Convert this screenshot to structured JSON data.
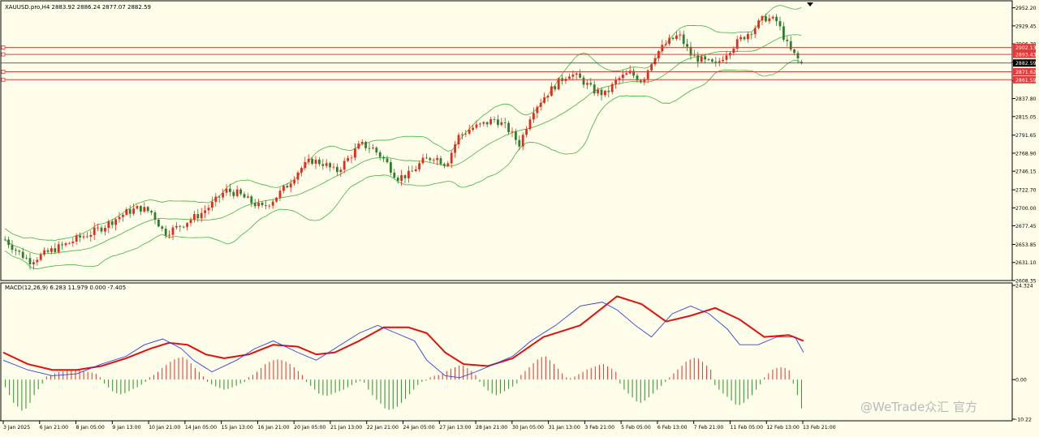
{
  "main_header": "XAUUSD.pro,H4  2883.92 2886.24 2877.07 2882.59",
  "macd_header": "MACD(12,26,9) 6.283 11.979 0.000 -7.405",
  "watermark": "@WeTrade众汇 官方",
  "colors": {
    "background": "#fffeea",
    "bull": "#e8291c",
    "bear": "#2f7d2f",
    "bollinger": "#3cb43c",
    "hline": "#e53a3a",
    "price_line": "#333333",
    "macd": "#2f3fe0",
    "signal": "#e01010",
    "hist_pos": "#e8403a",
    "hist_neg": "#3a9a3a"
  },
  "chart_data": [
    {
      "type": "candlestick",
      "symbol": "XAUUSD.pro",
      "timeframe": "H4",
      "last_ohlc": {
        "open": 2883.92,
        "high": 2886.24,
        "low": 2877.07,
        "close": 2882.59
      },
      "ylim": [
        2608.35,
        2960.0
      ],
      "y_ticks": [
        "2952.20",
        "2929.45",
        "2906.70",
        "2883.95",
        "2860.30",
        "2837.80",
        "2815.05",
        "2791.65",
        "2768.90",
        "2746.15",
        "2722.70",
        "2700.00",
        "2677.45",
        "2653.85",
        "2631.10",
        "2608.35"
      ],
      "x_labels": [
        "3 Jan 2025",
        "6 Jan 21:00",
        "8 Jan 05:00",
        "9 Jan 13:00",
        "10 Jan 21:00",
        "14 Jan 05:00",
        "15 Jan 13:00",
        "16 Jan 21:00",
        "20 Jan 05:00",
        "21 Jan 13:00",
        "22 Jan 21:00",
        "24 Jan 05:00",
        "27 Jan 13:00",
        "28 Jan 21:00",
        "30 Jan 05:00",
        "31 Jan 13:00",
        "3 Feb 21:00",
        "5 Feb 05:00",
        "6 Feb 13:00",
        "7 Feb 21:00",
        "11 Feb 05:00",
        "12 Feb 13:00",
        "13 Feb 21:00"
      ],
      "horizontal_lines": [
        {
          "label": "2902.13",
          "value": 2902.13
        },
        {
          "label": "2893.43",
          "value": 2893.43
        },
        {
          "label": "2871.62",
          "value": 2871.62
        },
        {
          "label": "2861.59",
          "value": 2861.59
        }
      ],
      "current_price": {
        "label": "2882.59",
        "value": 2882.59
      },
      "close_path": [
        [
          0,
          2660
        ],
        [
          8,
          2645
        ],
        [
          16,
          2633
        ],
        [
          24,
          2640
        ],
        [
          32,
          2648
        ],
        [
          40,
          2654
        ],
        [
          48,
          2662
        ],
        [
          56,
          2668
        ],
        [
          64,
          2676
        ],
        [
          72,
          2686
        ],
        [
          80,
          2695
        ],
        [
          88,
          2700
        ],
        [
          96,
          2694
        ],
        [
          104,
          2668
        ],
        [
          112,
          2675
        ],
        [
          120,
          2684
        ],
        [
          128,
          2693
        ],
        [
          136,
          2706
        ],
        [
          144,
          2722
        ],
        [
          152,
          2718
        ],
        [
          160,
          2708
        ],
        [
          168,
          2700
        ],
        [
          176,
          2712
        ],
        [
          184,
          2728
        ],
        [
          192,
          2748
        ],
        [
          200,
          2760
        ],
        [
          208,
          2756
        ],
        [
          216,
          2745
        ],
        [
          224,
          2762
        ],
        [
          232,
          2780
        ],
        [
          240,
          2775
        ],
        [
          248,
          2760
        ],
        [
          256,
          2738
        ],
        [
          264,
          2742
        ],
        [
          272,
          2758
        ],
        [
          280,
          2765
        ],
        [
          288,
          2755
        ],
        [
          296,
          2790
        ],
        [
          304,
          2800
        ],
        [
          312,
          2805
        ],
        [
          320,
          2812
        ],
        [
          328,
          2800
        ],
        [
          336,
          2780
        ],
        [
          344,
          2822
        ],
        [
          352,
          2840
        ],
        [
          360,
          2856
        ],
        [
          368,
          2870
        ],
        [
          376,
          2862
        ],
        [
          384,
          2848
        ],
        [
          392,
          2843
        ],
        [
          400,
          2862
        ],
        [
          408,
          2870
        ],
        [
          416,
          2860
        ],
        [
          424,
          2892
        ],
        [
          432,
          2908
        ],
        [
          440,
          2918
        ],
        [
          448,
          2892
        ],
        [
          456,
          2885
        ],
        [
          464,
          2880
        ],
        [
          472,
          2898
        ],
        [
          480,
          2912
        ],
        [
          488,
          2925
        ],
        [
          496,
          2940
        ],
        [
          504,
          2935
        ],
        [
          512,
          2900
        ],
        [
          520,
          2882.59
        ]
      ],
      "close_path_note_x": "bar index 0–520"
    },
    {
      "type": "line",
      "indicator": "MACD",
      "params": [
        12,
        26,
        9
      ],
      "values_shown": {
        "macd": 6.283,
        "signal": 11.979,
        "hist_zero": 0.0,
        "hist": -7.405
      },
      "ylim": [
        -10.22,
        24.324
      ],
      "y_ticks": [
        "24.324",
        "0.00",
        "-10.22"
      ],
      "macd_path": [
        [
          0,
          5
        ],
        [
          20,
          2.5
        ],
        [
          40,
          1
        ],
        [
          60,
          1.5
        ],
        [
          80,
          4
        ],
        [
          100,
          6
        ],
        [
          115,
          9
        ],
        [
          130,
          10.5
        ],
        [
          145,
          8
        ],
        [
          155,
          5
        ],
        [
          170,
          2
        ],
        [
          190,
          5
        ],
        [
          205,
          8
        ],
        [
          220,
          10
        ],
        [
          240,
          7
        ],
        [
          255,
          5
        ],
        [
          270,
          8
        ],
        [
          290,
          12
        ],
        [
          305,
          14
        ],
        [
          320,
          12
        ],
        [
          335,
          10
        ],
        [
          345,
          5
        ],
        [
          360,
          1
        ],
        [
          372,
          0.5
        ],
        [
          385,
          2
        ],
        [
          400,
          4
        ],
        [
          415,
          6
        ],
        [
          430,
          10
        ],
        [
          450,
          14
        ],
        [
          470,
          19
        ],
        [
          488,
          20
        ],
        [
          500,
          18
        ],
        [
          515,
          14
        ],
        [
          528,
          11
        ],
        [
          545,
          17
        ],
        [
          560,
          19
        ],
        [
          575,
          17
        ],
        [
          590,
          13
        ],
        [
          600,
          9
        ],
        [
          615,
          9
        ],
        [
          630,
          11
        ],
        [
          645,
          11
        ],
        [
          652,
          7
        ]
      ],
      "signal_path": [
        [
          0,
          7
        ],
        [
          20,
          4
        ],
        [
          40,
          2.5
        ],
        [
          60,
          2.5
        ],
        [
          80,
          3.5
        ],
        [
          100,
          5.5
        ],
        [
          120,
          8
        ],
        [
          135,
          9.5
        ],
        [
          150,
          9
        ],
        [
          165,
          6.5
        ],
        [
          180,
          5.5
        ],
        [
          200,
          6.5
        ],
        [
          220,
          9
        ],
        [
          240,
          8.5
        ],
        [
          255,
          6.5
        ],
        [
          270,
          7
        ],
        [
          290,
          10
        ],
        [
          310,
          13.5
        ],
        [
          330,
          13.5
        ],
        [
          345,
          12
        ],
        [
          360,
          7
        ],
        [
          375,
          4
        ],
        [
          395,
          3.5
        ],
        [
          415,
          5.5
        ],
        [
          440,
          11
        ],
        [
          470,
          14
        ],
        [
          500,
          21.5
        ],
        [
          520,
          19.5
        ],
        [
          540,
          15
        ],
        [
          560,
          16.5
        ],
        [
          580,
          18.5
        ],
        [
          600,
          15.5
        ],
        [
          620,
          11
        ],
        [
          640,
          11.5
        ],
        [
          652,
          10
        ]
      ],
      "hist_bars": [
        -2,
        -4,
        -6,
        -7,
        -8,
        -7.5,
        -6,
        -4,
        -2.5,
        -1,
        0.8,
        1.2,
        1.6,
        2,
        2.2,
        2.4,
        2.6,
        2.6,
        2.4,
        2.2,
        2,
        1.8,
        1.5,
        0.6,
        -1,
        -2,
        -3,
        -3.5,
        -3.8,
        -3.5,
        -3,
        -2.4,
        -2,
        -1.3,
        -0.6,
        0.6,
        1.2,
        2,
        3,
        3.8,
        4.6,
        5.2,
        5.6,
        5.8,
        5.2,
        4.2,
        3,
        2,
        0.8,
        -0.6,
        -1.2,
        -1.8,
        -2.2,
        -2.6,
        -2.4,
        -2,
        -1.6,
        -1,
        -0.6,
        0.6,
        1.2,
        2,
        3,
        4,
        4.6,
        5,
        5.2,
        5,
        4.6,
        4,
        3.2,
        2.2,
        1.2,
        -0.6,
        -1.6,
        -2.6,
        -3.6,
        -4,
        -4.2,
        -3.8,
        -3.4,
        -3,
        -2.6,
        -2,
        -1.4,
        -0.8,
        -0.4,
        -0.8,
        -2.6,
        -4,
        -5.2,
        -6.2,
        -7.4,
        -7.8,
        -7.6,
        -7,
        -6,
        -5,
        -3.8,
        -2.6,
        -1.4,
        -0.6,
        -0.3,
        0.6,
        1,
        1.2,
        1.6,
        2.2,
        2.8,
        3.2,
        3.6,
        3.6,
        3,
        2.2,
        1.2,
        -0.6,
        -1.8,
        -2.8,
        -3.6,
        -4,
        -3.6,
        -3,
        -2.4,
        -1.8,
        -1,
        1.2,
        2.2,
        3.2,
        4.2,
        5.2,
        5.8,
        6,
        5,
        4,
        2.8,
        1.6,
        0.6,
        0.4,
        0.8,
        1.4,
        2,
        2.6,
        3,
        3.4,
        3.8,
        4,
        3.4,
        2.8,
        2,
        -1,
        -2.6,
        -3.6,
        -4.6,
        -5.6,
        -6,
        -5.4,
        -4.6,
        -3.6,
        -2.6,
        -1.6,
        -0.6,
        0.6,
        1.6,
        2.6,
        3.6,
        4.6,
        5.2,
        5.6,
        5.4,
        4.6,
        3.6,
        2.6,
        -1.4,
        -2.6,
        -3.6,
        -4.4,
        -5.4,
        -6.4,
        -6.6,
        -6,
        -5,
        -4,
        -2.6,
        -1.2,
        0.6,
        1.6,
        2.6,
        3,
        3.2,
        3,
        2.4,
        -1,
        -4,
        -7.4
      ],
      "hist_note_x": "bars spread across MACD range, index order left→right"
    }
  ]
}
